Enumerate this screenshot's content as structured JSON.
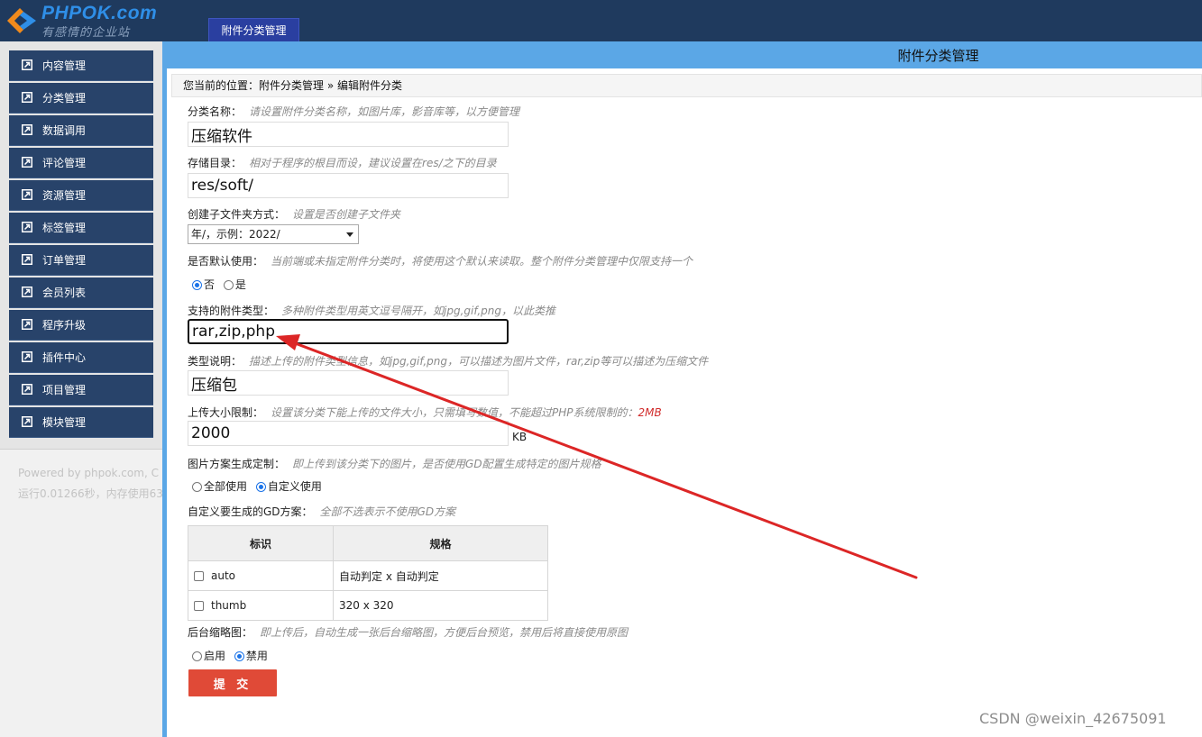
{
  "header": {
    "logo_title": "PHPOK.com",
    "logo_slogan": "有感情的企业站",
    "active_tab": "附件分类管理"
  },
  "sidebar": {
    "items": [
      {
        "label": "内容管理"
      },
      {
        "label": "分类管理"
      },
      {
        "label": "数据调用"
      },
      {
        "label": "评论管理"
      },
      {
        "label": "资源管理"
      },
      {
        "label": "标签管理"
      },
      {
        "label": "订单管理"
      },
      {
        "label": "会员列表"
      },
      {
        "label": "程序升级"
      },
      {
        "label": "插件中心"
      },
      {
        "label": "项目管理"
      },
      {
        "label": "模块管理"
      }
    ],
    "footer_line1": "Powered by phpok.com, C",
    "footer_line2": "运行0.01266秒，内存使用63"
  },
  "main": {
    "title": "附件分类管理",
    "breadcrumb": "您当前的位置：附件分类管理 » 编辑附件分类"
  },
  "form": {
    "name": {
      "label": "分类名称：",
      "note": "请设置附件分类名称，如图片库，影音库等，以方便管理",
      "value": "压缩软件"
    },
    "folder": {
      "label": "存储目录：",
      "note": "相对于程序的根目而设，建议设置在res/之下的目录",
      "value": "res/soft/"
    },
    "subfolder": {
      "label": "创建子文件夹方式：",
      "note": "设置是否创建子文件夹",
      "selected": "年/，示例：2022/"
    },
    "is_default": {
      "label": "是否默认使用：",
      "note": "当前端或未指定附件分类时，将使用这个默认来读取。整个附件分类管理中仅限支持一个",
      "options": [
        "否",
        "是"
      ],
      "selected": "否"
    },
    "types": {
      "label": "支持的附件类型：",
      "note": "多种附件类型用英文逗号隔开，如jpg,gif,png，以此类推",
      "value": "rar,zip,php"
    },
    "type_desc": {
      "label": "类型说明：",
      "note": "描述上传的附件类型信息，如jpg,gif,png，可以描述为图片文件，rar,zip等可以描述为压缩文件",
      "value": "压缩包"
    },
    "size_limit": {
      "label": "上传大小限制：",
      "note": "设置该分类下能上传的文件大小，只需填写数值，不能超过PHP系统限制的：",
      "warn": "2MB",
      "value": "2000",
      "unit": "KB"
    },
    "gd_mode": {
      "label": "图片方案生成定制：",
      "note": "即上传到该分类下的图片，是否使用GD配置生成特定的图片规格",
      "options": [
        "全部使用",
        "自定义使用"
      ],
      "selected": "自定义使用"
    },
    "gd_custom": {
      "label": "自定义要生成的GD方案：",
      "note": "全部不选表示不使用GD方案",
      "columns": [
        "标识",
        "规格"
      ],
      "rows": [
        {
          "id": "auto",
          "spec": "自动判定 x 自动判定"
        },
        {
          "id": "thumb",
          "spec": "320 x 320"
        }
      ]
    },
    "thumb": {
      "label": "后台缩略图：",
      "note": "即上传后，自动生成一张后台缩略图，方便后台预览，禁用后将直接使用原图",
      "options": [
        "启用",
        "禁用"
      ],
      "selected": "禁用"
    },
    "submit_label": "提 交"
  },
  "watermark": "CSDN @weixin_42675091",
  "colors": {
    "topbar": "#1f3a5e",
    "sidebar_item": "#28436a",
    "main_border": "#5ba7e6",
    "submit": "#e04a37",
    "arrow": "#dc2626"
  }
}
